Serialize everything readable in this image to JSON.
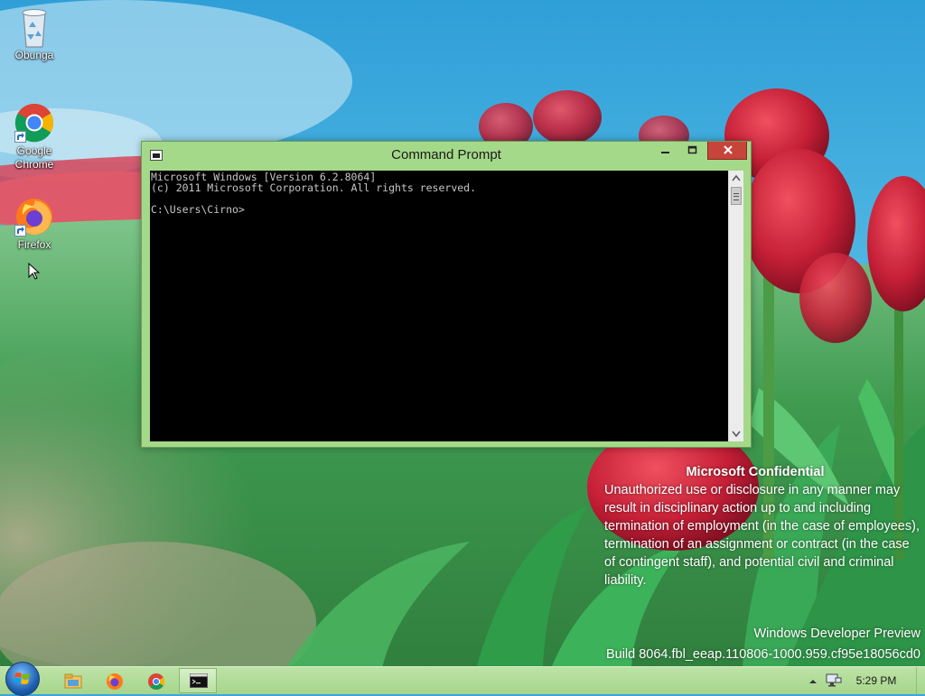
{
  "desktop": {
    "icons": [
      {
        "label": "Obunga",
        "icon": "recycle-bin-icon"
      },
      {
        "label": "Google Chrome",
        "icon": "chrome-icon"
      },
      {
        "label": "Firefox",
        "icon": "firefox-icon"
      }
    ]
  },
  "window": {
    "title": "Command Prompt",
    "console_lines": [
      "Microsoft Windows [Version 6.2.8064]",
      "(c) 2011 Microsoft Corporation. All rights reserved.",
      "",
      "C:\\Users\\Cirno>"
    ],
    "controls": [
      "minimize",
      "maximize",
      "close"
    ]
  },
  "watermark": {
    "title": "Microsoft Confidential",
    "body": "Unauthorized use or disclosure in any manner may result in disciplinary action up to and including termination of employment (in the case of employees), termination of an assignment or contract (in the case of contingent staff), and potential civil and criminal liability.",
    "line1": "Windows Developer Preview",
    "line2": "Build 8064.fbl_eeap.110806-1000.959.cf95e18056cd0"
  },
  "taskbar": {
    "pinned": [
      "file-explorer-icon",
      "firefox-icon",
      "chrome-icon",
      "command-prompt-icon"
    ],
    "active": "command-prompt-icon",
    "clock": "5:29 PM"
  },
  "colors": {
    "window_frame": "#a5d98a",
    "close_button": "#c7443b",
    "taskbar": "#b2dc9a",
    "sky": "#3aa7d8"
  }
}
